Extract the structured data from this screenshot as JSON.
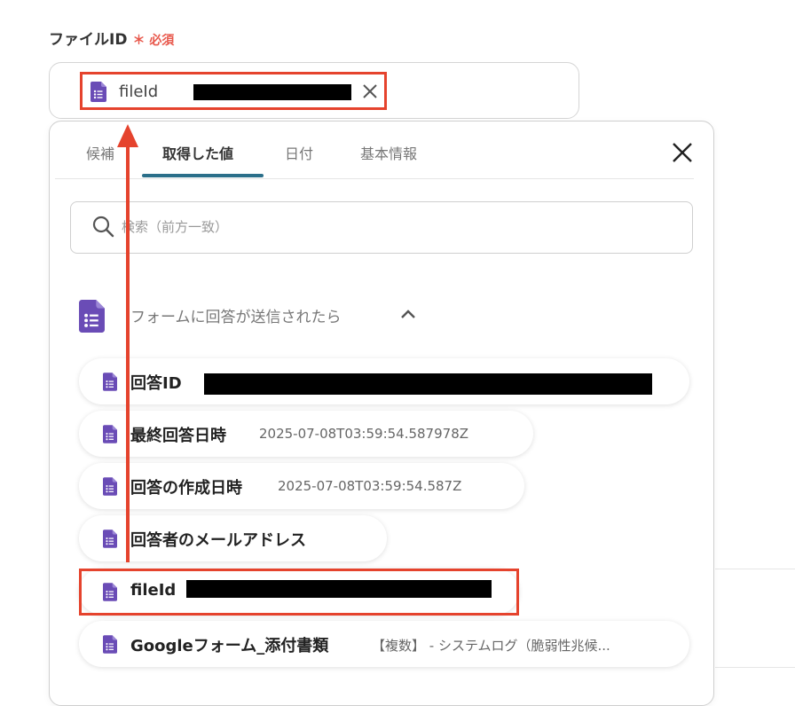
{
  "field": {
    "label": "ファイルID",
    "required_mark": "＊",
    "required_text": "必須",
    "selected_token": {
      "label": "fileId",
      "clear_icon": "close-icon"
    }
  },
  "panel": {
    "tabs": [
      {
        "label": "候補",
        "active": false
      },
      {
        "label": "取得した値",
        "active": true
      },
      {
        "label": "日付",
        "active": false
      },
      {
        "label": "基本情報",
        "active": false
      }
    ],
    "search": {
      "placeholder": "検索（前方一致）"
    },
    "section": {
      "title": "フォームに回答が送信されたら",
      "icon": "google-forms-icon",
      "expanded": true
    },
    "items": [
      {
        "label": "回答ID",
        "value": ""
      },
      {
        "label": "最終回答日時",
        "value": "2025-07-08T03:59:54.587978Z"
      },
      {
        "label": "回答の作成日時",
        "value": "2025-07-08T03:59:54.587Z"
      },
      {
        "label": "回答者のメールアドレス",
        "value": ""
      },
      {
        "label": "fileId",
        "value": ""
      },
      {
        "label": "Googleフォーム_添付書類",
        "value": "【複数】 - システムログ（脆弱性兆候..."
      }
    ]
  },
  "colors": {
    "highlight": "#e5432d",
    "accent": "#2b6f8a",
    "forms_purple": "#6a4cb6",
    "required": "#e8584c"
  }
}
